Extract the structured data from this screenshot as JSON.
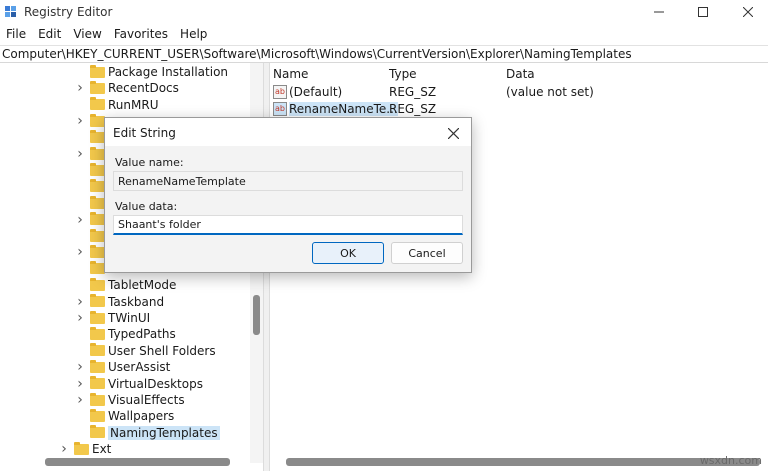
{
  "window": {
    "title": "Registry Editor",
    "minimize_icon": "minimize-icon",
    "maximize_icon": "maximize-icon",
    "close_icon": "close-icon"
  },
  "menu": [
    "File",
    "Edit",
    "View",
    "Favorites",
    "Help"
  ],
  "address": "Computer\\HKEY_CURRENT_USER\\Software\\Microsoft\\Windows\\CurrentVersion\\Explorer\\NamingTemplates",
  "tree": {
    "items": [
      {
        "label": "Package Installation",
        "expandable": false
      },
      {
        "label": "RecentDocs",
        "expandable": true
      },
      {
        "label": "RunMRU",
        "expandable": false
      },
      {
        "label": "",
        "expandable": true
      },
      {
        "label": "",
        "expandable": false
      },
      {
        "label": "",
        "expandable": true
      },
      {
        "label": "",
        "expandable": false
      },
      {
        "label": "",
        "expandable": false
      },
      {
        "label": "",
        "expandable": false
      },
      {
        "label": "",
        "expandable": true
      },
      {
        "label": "",
        "expandable": false
      },
      {
        "label": "",
        "expandable": true
      },
      {
        "label": "",
        "expandable": false
      },
      {
        "label": "TabletMode",
        "expandable": false
      },
      {
        "label": "Taskband",
        "expandable": true
      },
      {
        "label": "TWinUI",
        "expandable": true
      },
      {
        "label": "TypedPaths",
        "expandable": false
      },
      {
        "label": "User Shell Folders",
        "expandable": false
      },
      {
        "label": "UserAssist",
        "expandable": true
      },
      {
        "label": "VirtualDesktops",
        "expandable": true
      },
      {
        "label": "VisualEffects",
        "expandable": true
      },
      {
        "label": "Wallpapers",
        "expandable": false
      },
      {
        "label": "NamingTemplates",
        "expandable": false,
        "selected": true
      },
      {
        "label": "Ext",
        "expandable": true
      }
    ]
  },
  "values_pane": {
    "columns": [
      "Name",
      "Type",
      "Data"
    ],
    "rows": [
      {
        "name": "(Default)",
        "type": "REG_SZ",
        "data": "(value not set)",
        "icon": "string-value-icon"
      },
      {
        "name": "RenameNameTe...",
        "type": "REG_SZ",
        "data": "",
        "icon": "string-value-icon",
        "selected": true
      }
    ]
  },
  "dialog": {
    "title": "Edit String",
    "value_name_label": "Value name:",
    "value_name": "RenameNameTemplate",
    "value_data_label": "Value data:",
    "value_data": "Shaant's folder",
    "ok_label": "OK",
    "cancel_label": "Cancel"
  },
  "watermark": "wsxdn.com"
}
